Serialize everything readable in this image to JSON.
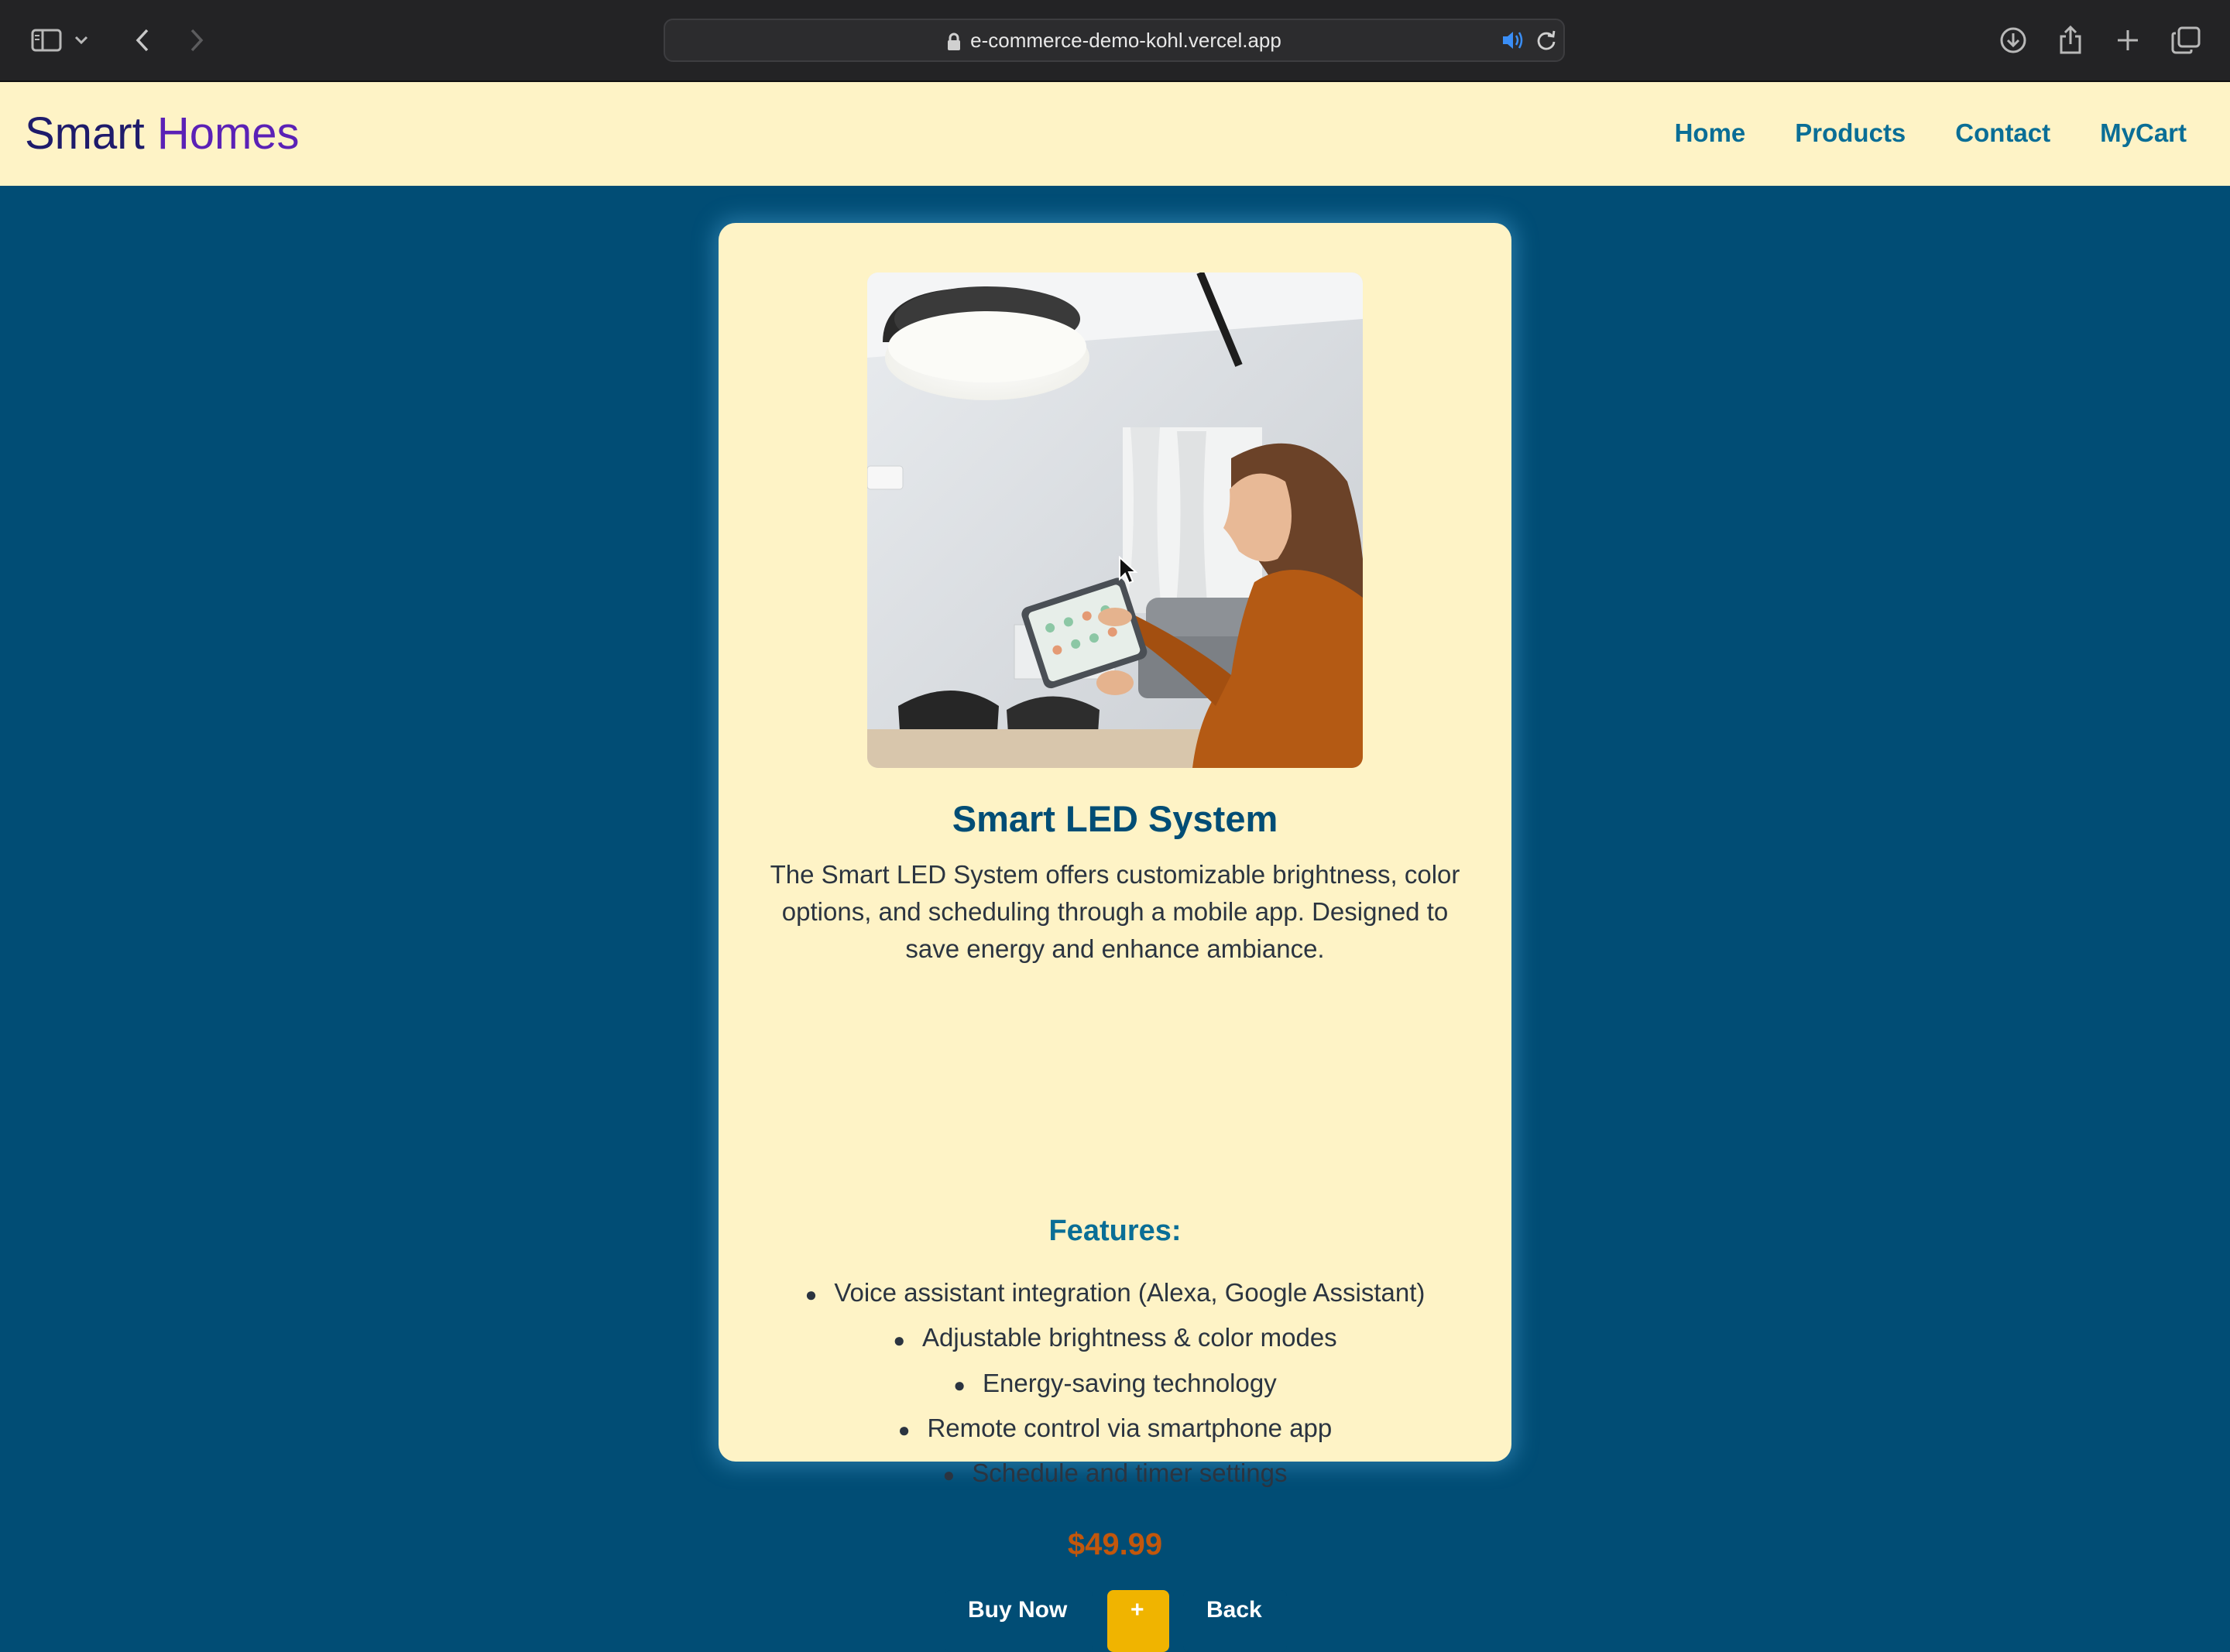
{
  "browser": {
    "url": "e-commerce-demo-kohl.vercel.app",
    "icons": [
      "sidebar-icon",
      "chevron-down-icon",
      "back-icon",
      "forward-icon",
      "lock-icon",
      "audio-icon",
      "reload-icon",
      "download-icon",
      "share-icon",
      "new-tab-icon",
      "tabs-overview-icon"
    ]
  },
  "header": {
    "brand_word1": "Smart",
    "brand_word2": "Homes",
    "nav": [
      "Home",
      "Products",
      "Contact",
      "MyCart"
    ]
  },
  "product": {
    "name": "Smart LED System",
    "description": "The Smart LED System offers customizable brightness, color options, and scheduling through a mobile app. Designed to save energy and enhance ambiance.",
    "features_heading": "Features:",
    "features": [
      "Voice assistant integration (Alexa, Google Assistant)",
      "Adjustable brightness & color modes",
      "Energy-saving technology",
      "Remote control via smartphone app",
      "Schedule and timer settings"
    ],
    "price": "$49.99",
    "buttons": [
      "Buy Now",
      "+",
      "Back"
    ]
  },
  "colors": {
    "page_bg": "#014d75",
    "card_bg": "#fef3c6",
    "accent": "#0a6e96",
    "price": "#c2570c",
    "qty_button": "#f0b400"
  }
}
